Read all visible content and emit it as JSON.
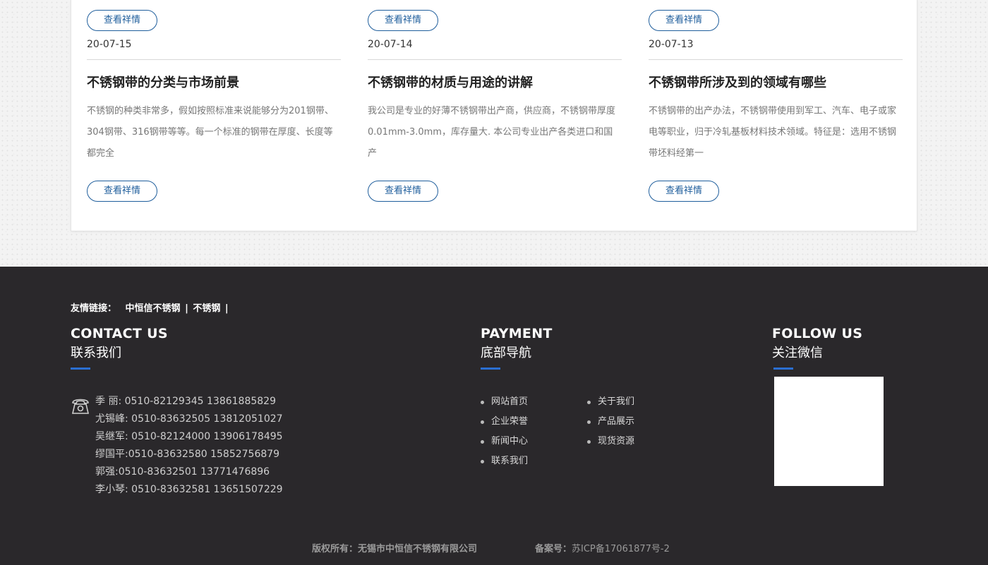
{
  "news": [
    {
      "top_button": "查看祥情",
      "date": "20-07-15",
      "title": "不锈钢带的分类与市场前景",
      "desc": "不锈钢的种类非常多，假如按照标准来说能够分为201钢带、304钢带、316钢带等等。每一个标准的钢带在厚度、长度等都完全",
      "bottom_button": "查看祥情"
    },
    {
      "top_button": "查看祥情",
      "date": "20-07-14",
      "title": "不锈钢带的材质与用途的讲解",
      "desc": "我公司是专业的好薄不锈钢带出产商，供应商，不锈钢带厚度0.01mm-3.0mm，库存量大. 本公司专业出产各类进口和国产",
      "bottom_button": "查看祥情"
    },
    {
      "top_button": "查看祥情",
      "date": "20-07-13",
      "title": "不锈钢带所涉及到的领域有哪些",
      "desc": "不锈钢带的出产办法，不锈钢带使用到军工、汽车、电子或家电等职业，归于冷轧基板材料技术领域。特征是：选用不锈钢带坯料经第一",
      "bottom_button": "查看祥情"
    }
  ],
  "footer": {
    "links_label": "友情链接：",
    "links": [
      "中恒信不锈钢",
      "不锈钢"
    ],
    "contact": {
      "title_en": "CONTACT US",
      "title_cn": "联系我们",
      "icon": "telephone-icon",
      "lines": [
        "季 丽: 0510-82129345 13861885829",
        "尤锡峰: 0510-83632505 13812051027",
        "吴继军: 0510-82124000 13906178495",
        "缪国平:0510-83632580 15852756879",
        "郭强:0510-83632501 13771476896",
        "李小琴: 0510-83632581 13651507229"
      ]
    },
    "payment": {
      "title_en": "PAYMENT",
      "title_cn": "底部导航",
      "col1": [
        "网站首页",
        "企业荣誉",
        "新闻中心",
        "联系我们"
      ],
      "col2": [
        "关于我们",
        "产品展示",
        "现货资源"
      ]
    },
    "follow": {
      "title_en": "FOLLOW US",
      "title_cn": "关注微信"
    },
    "copyright": "版权所有：无锡市中恒信不锈钢有限公司",
    "icp_label": "备案号：",
    "icp_value": "苏ICP备17061877号-2"
  },
  "colors": {
    "accent_blue": "#1f5e9c",
    "footer_bg": "#2a282b",
    "bar_blue": "#2b6fd1"
  }
}
